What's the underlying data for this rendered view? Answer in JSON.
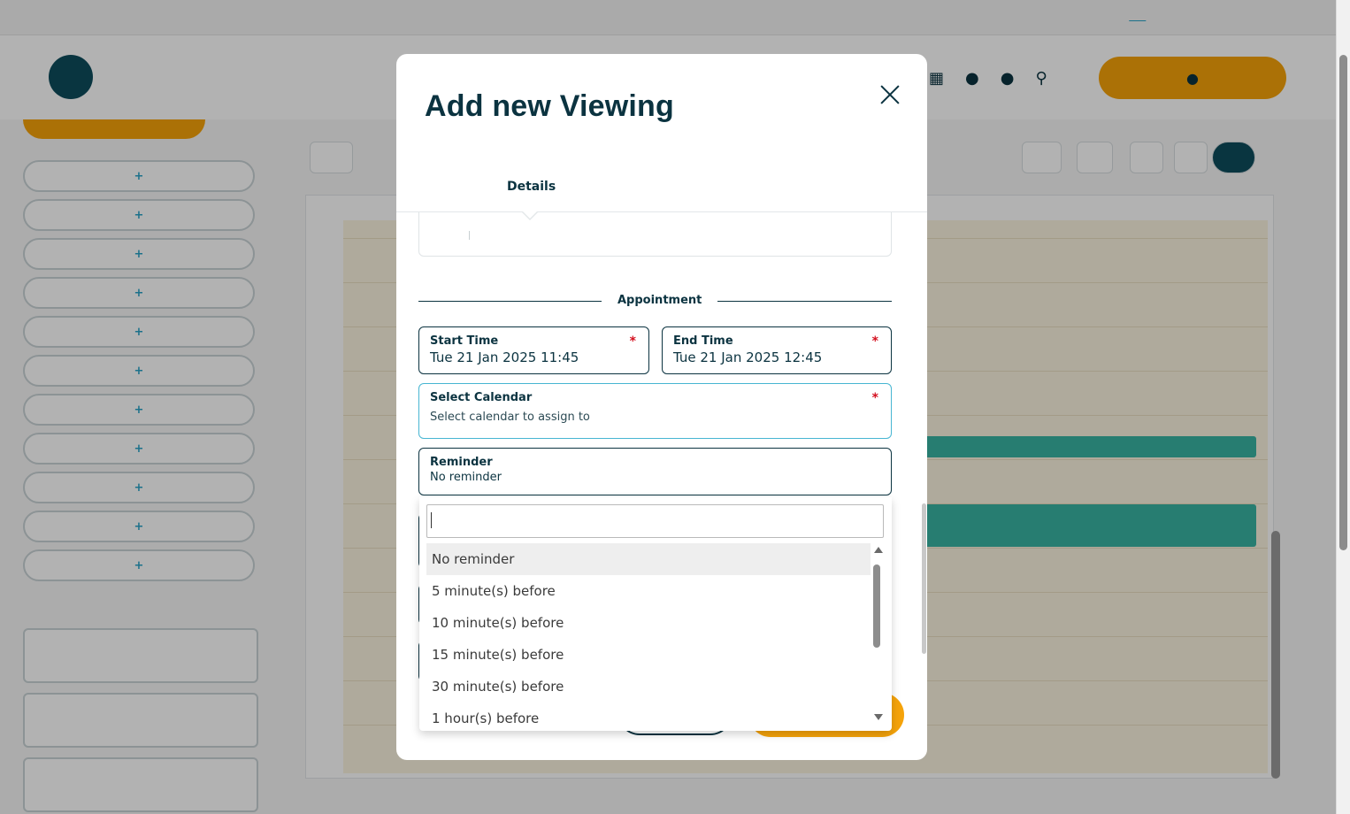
{
  "modal": {
    "title": "Add new Viewing",
    "tab_details": "Details",
    "section_appointment": "Appointment",
    "start_time": {
      "label": "Start Time",
      "value": "Tue 21 Jan 2025 11:45",
      "required": "*"
    },
    "end_time": {
      "label": "End Time",
      "value": "Tue 21 Jan 2025 12:45",
      "required": "*"
    },
    "calendar": {
      "label": "Select Calendar",
      "placeholder": "Select calendar to assign to",
      "required": "*"
    },
    "reminder": {
      "label": "Reminder",
      "value": "No reminder"
    }
  },
  "dropdown": {
    "search_value": "",
    "options": [
      "No reminder",
      "5 minute(s) before",
      "10 minute(s) before",
      "15 minute(s) before",
      "30 minute(s) before",
      "1 hour(s) before"
    ],
    "selected": "No reminder"
  },
  "colors": {
    "brand_dark": "#0b3340",
    "accent_orange": "#f5a30a",
    "required_red": "#d40f1e",
    "focus_blue": "#47b6d2"
  }
}
